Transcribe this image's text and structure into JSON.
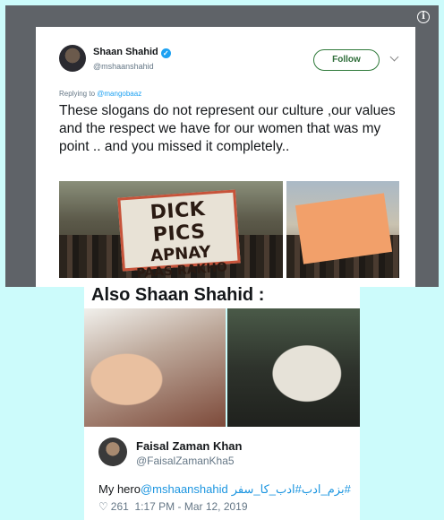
{
  "tweet_original": {
    "author_name": "Shaan Shahid",
    "author_handle": "@mshaanshahid",
    "follow_label": "Follow",
    "replying_prefix": "Replying to",
    "replying_to": "@mangobaaz",
    "text": "These slogans do not represent our culture ,our values and the respect we have for our women that was my point .. and you missed it completely..",
    "photo_sign_left": [
      "DICK PICS",
      "APNAY",
      "PAAS RAKHO"
    ]
  },
  "meme": {
    "title": "Also Shaan Shahid :"
  },
  "tweet_reply": {
    "author_name": "Faisal Zaman Khan",
    "author_handle": "@FaisalZamanKha5",
    "text_prefix": "My hero",
    "mention": "@mshaanshahid",
    "hashtags": "#بزم_ادب#ادب_کا_سفر",
    "likes": "261",
    "timestamp": "1:17 PM - Mar 12, 2019"
  },
  "colors": {
    "background": "#ccfbfb",
    "frame": "#5f6368",
    "link": "#1da1f2",
    "follow_border": "#2f7a3a"
  },
  "icons": {
    "verified": "verified-badge-icon",
    "info": "info-icon",
    "chevron": "chevron-down-icon",
    "heart": "heart-icon"
  }
}
